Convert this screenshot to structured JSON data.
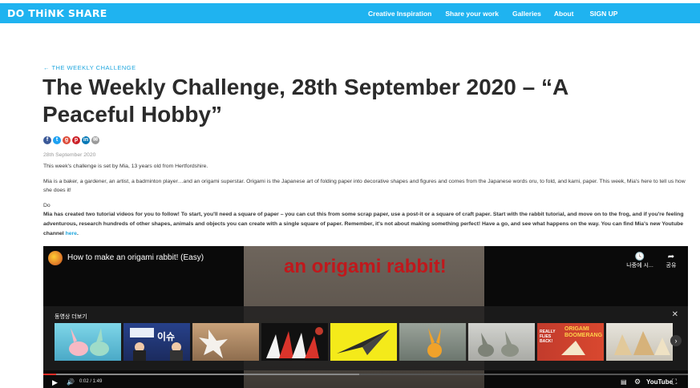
{
  "site": {
    "logo": "DO THiNK SHARE",
    "nav": [
      "Creative Inspiration",
      "Share your work",
      "Galleries",
      "About",
      "SIGN UP"
    ]
  },
  "article": {
    "back_link": "← THE WEEKLY CHALLENGE",
    "title": "The Weekly Challenge, 28th September 2020 – “A Peaceful Hobby”",
    "share_icons": [
      "facebook-icon",
      "twitter-icon",
      "google-plus-icon",
      "pinterest-icon",
      "linkedin-icon",
      "email-icon"
    ],
    "date": "28th September 2020",
    "intro": "This week's challenge is set by Mia, 13 years old from Hertfordshire.",
    "para2": "Mia is a baker, a gardener, an artist, a badminton player…and an origami superstar. Origami is the Japanese art of folding paper into decorative shapes and figures and comes from the Japanese words oru, to fold, and kami, paper. This week, Mia's here to tell us how she does it!",
    "do_heading": "Do",
    "para4": "Mia has created two tutorial videos for you to follow! To start, you'll need a square of paper – you can cut this from some scrap paper, use a post-it or a square of craft paper. Start with the rabbit tutorial, and move on to the frog, and if you're feeling adventurous, research hundreds of other shapes, animals and objects you can create with a single square of paper. Remember, it's not about making something perfect! Have a go, and see what happens on the way. You can find Mia's new Youtube channel",
    "para4_link": "here",
    "para4_end": "."
  },
  "video": {
    "title": "How to make an origami rabbit! (Easy)",
    "banner_text": "an origami rabbit!",
    "watch_later_label": "나중에 시...",
    "share_label": "공유",
    "more_videos_label": "동영상 더보기",
    "close_symbol": "✕",
    "time": "0:02 / 1:49",
    "youtube_label": "YouTube",
    "progress_played": 0.02,
    "progress_buffered": 0.49,
    "thumbnails": [
      {
        "name": "thumb-origami-rabbits"
      },
      {
        "name": "thumb-news-issue",
        "text": "이슈"
      },
      {
        "name": "thumb-paper-star"
      },
      {
        "name": "thumb-paper-claws"
      },
      {
        "name": "thumb-paper-plane"
      },
      {
        "name": "thumb-paper-bunny"
      },
      {
        "name": "thumb-paper-rabbits-grey"
      },
      {
        "name": "thumb-origami-boomerang",
        "text": "ORIGAMI BOOMERANG",
        "text2": "REALLY FLIES BACK!"
      },
      {
        "name": "thumb-origami-dogs"
      }
    ]
  },
  "colors": {
    "brand_blue": "#1fb3f0",
    "link_blue": "#1fa6de",
    "progress_red": "#e52d27"
  }
}
